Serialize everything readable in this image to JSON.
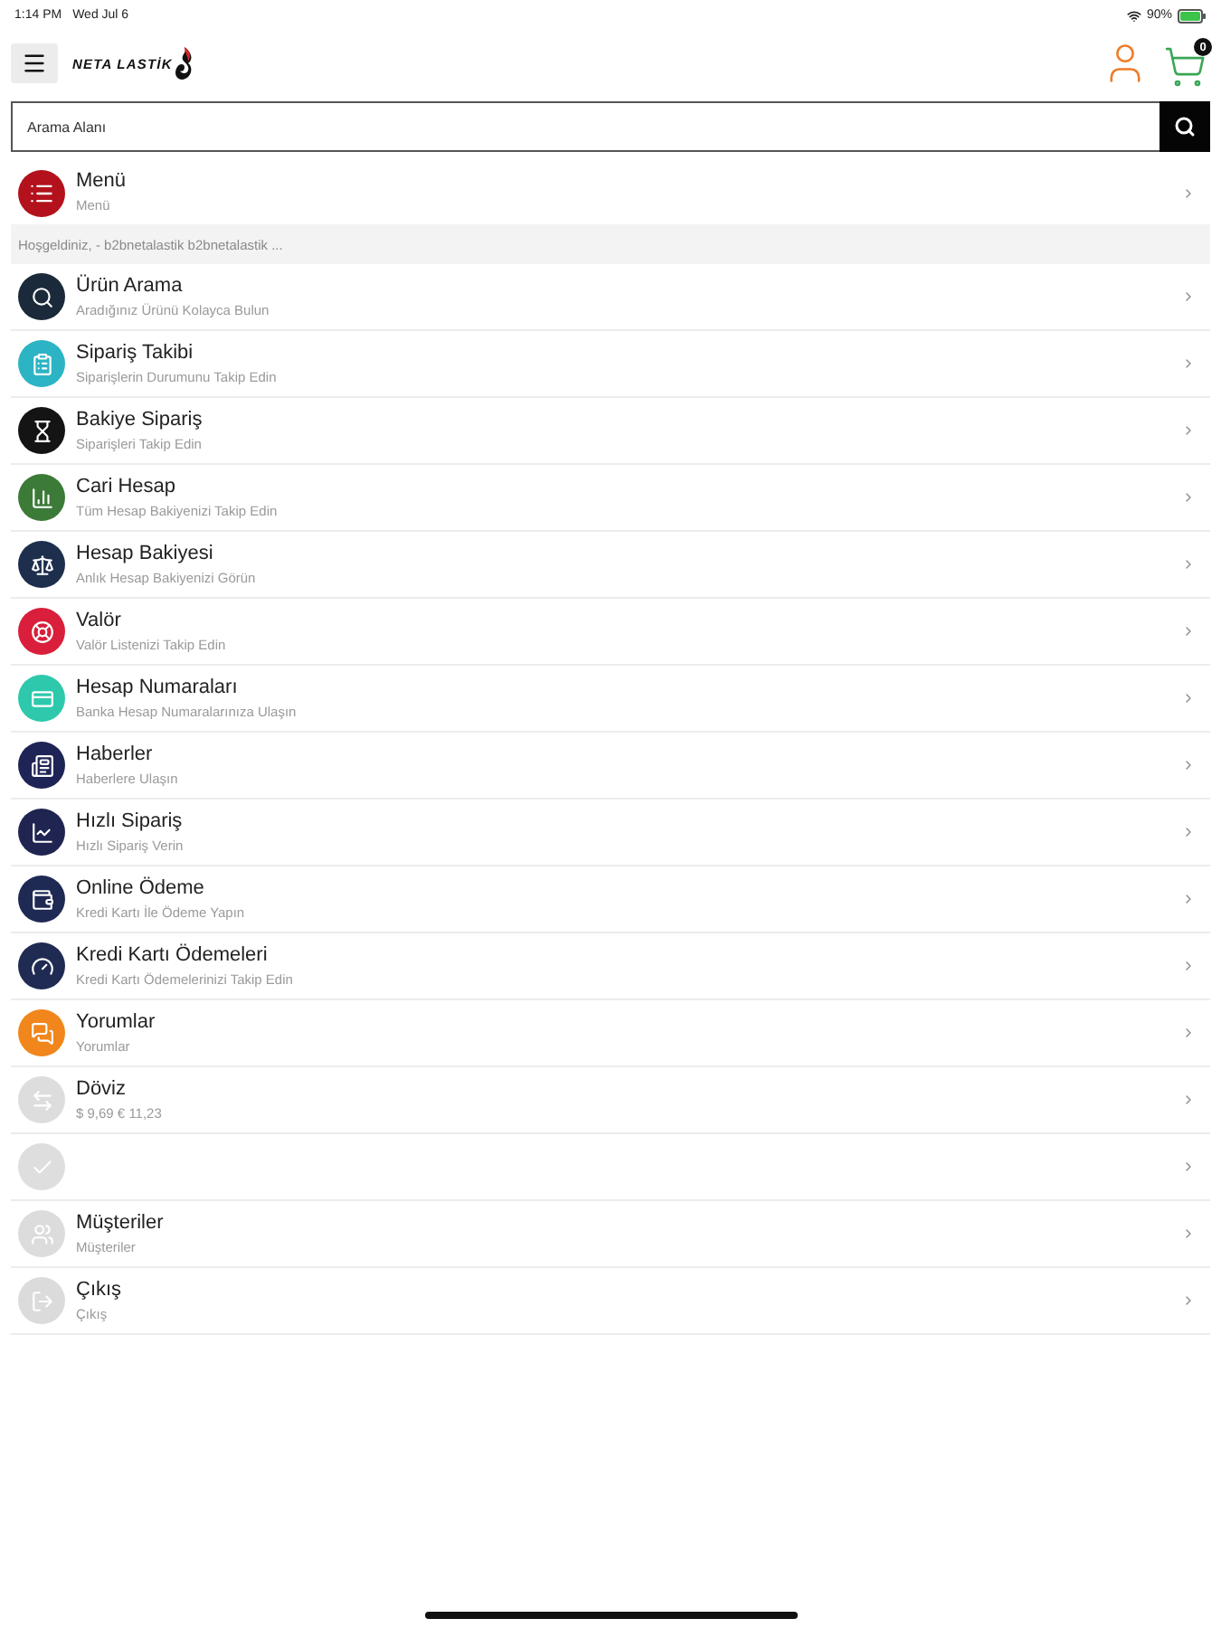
{
  "status_bar": {
    "time": "1:14 PM",
    "date": "Wed Jul 6",
    "battery": "90%"
  },
  "header": {
    "logo": "NETA LASTİK",
    "cart_count": "0"
  },
  "search": {
    "placeholder": "Arama Alanı"
  },
  "menu_header": {
    "title": "Menü",
    "subtitle": "Menü"
  },
  "welcome": "Hoşgeldiniz, - b2bnetalastik b2bnetalastik ...",
  "menu_items": [
    {
      "title": "Ürün Arama",
      "subtitle": "Aradığınız Ürünü Kolayca Bulun",
      "color": "#1b2a3a"
    },
    {
      "title": "Sipariş Takibi",
      "subtitle": "Siparişlerin Durumunu Takip Edin",
      "color": "#2db4c4"
    },
    {
      "title": "Bakiye Sipariş",
      "subtitle": "Siparişleri Takip Edin",
      "color": "#141414"
    },
    {
      "title": "Cari Hesap",
      "subtitle": "Tüm Hesap Bakiyenizi Takip Edin",
      "color": "#3c7a38"
    },
    {
      "title": "Hesap Bakiyesi",
      "subtitle": "Anlık Hesap Bakiyenizi Görün",
      "color": "#1e2f4e"
    },
    {
      "title": "Valör",
      "subtitle": "Valör Listenizi Takip Edin",
      "color": "#d91f3b"
    },
    {
      "title": "Hesap Numaraları",
      "subtitle": "Banka Hesap Numaralarınıza Ulaşın",
      "color": "#2ec8ad"
    },
    {
      "title": "Haberler",
      "subtitle": "Haberlere Ulaşın",
      "color": "#1f2456"
    },
    {
      "title": "Hızlı Sipariş",
      "subtitle": "Hızlı Sipariş Verin",
      "color": "#1f2550"
    },
    {
      "title": "Online Ödeme",
      "subtitle": "Kredi Kartı İle Ödeme Yapın",
      "color": "#1e2a54"
    },
    {
      "title": "Kredi Kartı Ödemeleri",
      "subtitle": "Kredi Kartı Ödemelerinizi Takip Edin",
      "color": "#1f2b52"
    },
    {
      "title": "Yorumlar",
      "subtitle": "Yorumlar",
      "color": "#f0861c"
    },
    {
      "title": "Döviz",
      "subtitle": "$ 9,69  € 11,23",
      "color": "#dddddd"
    },
    {
      "color": "#dedede"
    },
    {
      "title": "Müşteriler",
      "subtitle": "Müşteriler",
      "color": "#dcdcdc"
    },
    {
      "title": "Çıkış",
      "subtitle": "Çıkış",
      "color": "#dbdbdb"
    }
  ]
}
